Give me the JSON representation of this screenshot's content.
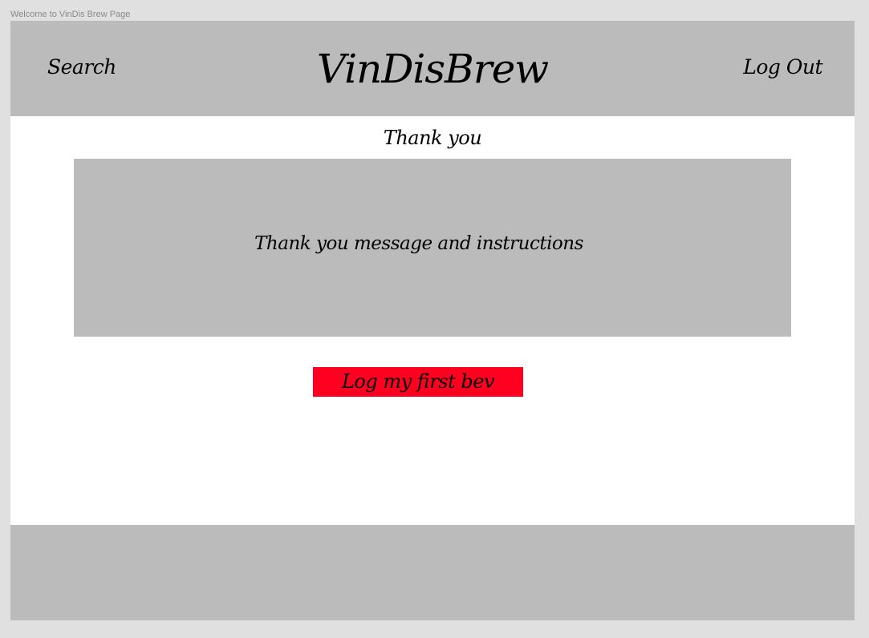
{
  "frame": {
    "label": "Welcome to VinDis Brew Page"
  },
  "header": {
    "search_label": "Search",
    "brand": "VinDisBrew",
    "logout_label": "Log Out"
  },
  "main": {
    "heading": "Thank you",
    "message": "Thank you message and instructions",
    "cta_label": "Log my first bev"
  },
  "colors": {
    "header_bg": "#bbbbbb",
    "footer_bg": "#bbbbbb",
    "message_bg": "#bbbbbb",
    "cta_bg": "#fe0020",
    "page_bg": "#ffffff",
    "canvas_bg": "#e0e0e0"
  }
}
